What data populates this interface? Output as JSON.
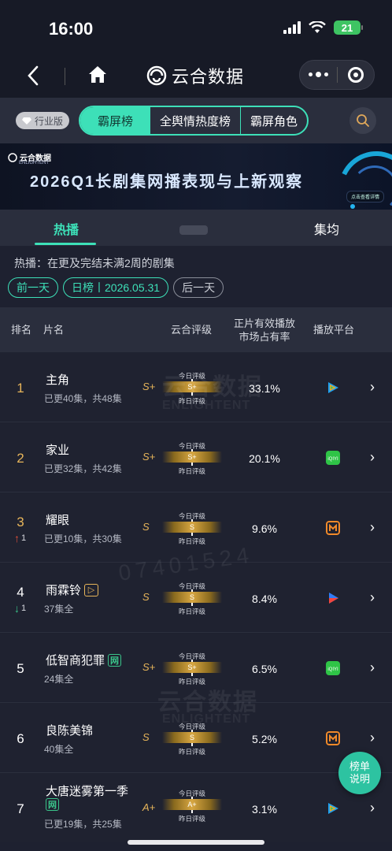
{
  "status_bar": {
    "time": "16:00",
    "battery": "21"
  },
  "nav": {
    "brand": "云合数据"
  },
  "tabs": {
    "industry_badge": "行业版",
    "items": [
      {
        "label": "霸屏榜",
        "active": true
      },
      {
        "label": "全舆情热度榜",
        "active": false
      },
      {
        "label": "霸屏角色",
        "active": false
      }
    ]
  },
  "banner": {
    "logo_cn": "云合数据",
    "logo_en": "ENLIGHTENT",
    "title": "2026Q1长剧集网播表现与上新观察",
    "pill": "点击查看详情"
  },
  "sub_tabs": [
    {
      "label": "热播",
      "active": true
    },
    {
      "label": "",
      "active": false
    },
    {
      "label": "集均",
      "active": false
    }
  ],
  "description": "热播：在更及完结未满2周的剧集",
  "date_nav": {
    "prev": "前一天",
    "current": "日榜丨2026.05.31",
    "next": "后一天"
  },
  "table_header": {
    "rank": "排名",
    "title": "片名",
    "rating": "云合评级",
    "share_line1": "正片有效播放",
    "share_line2": "市场占有率",
    "platform": "播放平台"
  },
  "rating_labels": {
    "today": "今日评级",
    "yesterday": "昨日评级"
  },
  "rows": [
    {
      "rank": "1",
      "title": "主角",
      "subtitle": "已更40集，共48集",
      "grade": "S+",
      "grade_today": "S+",
      "share": "33.1%",
      "platform": "tencent-icon",
      "rank_color": "#e7b55a",
      "change": "",
      "change_dir": "",
      "tag": ""
    },
    {
      "rank": "2",
      "title": "家业",
      "subtitle": "已更32集，共42集",
      "grade": "S+",
      "grade_today": "S+",
      "share": "20.1%",
      "platform": "iqiyi-icon",
      "rank_color": "#e7b55a",
      "change": "",
      "change_dir": "",
      "tag": ""
    },
    {
      "rank": "3",
      "title": "耀眼",
      "subtitle": "已更10集，共30集",
      "grade": "S",
      "grade_today": "S",
      "share": "9.6%",
      "platform": "mango-icon",
      "rank_color": "#e7b55a",
      "change": "1",
      "change_dir": "up",
      "tag": ""
    },
    {
      "rank": "4",
      "title": "雨霖铃",
      "subtitle": "37集全",
      "grade": "S",
      "grade_today": "S",
      "share": "8.4%",
      "platform": "youku-icon",
      "rank_color": "#ffffff",
      "change": "1",
      "change_dir": "down",
      "tag": "youku-badge-icon"
    },
    {
      "rank": "5",
      "title": "低智商犯罪",
      "subtitle": "24集全",
      "grade": "S+",
      "grade_today": "S+",
      "share": "6.5%",
      "platform": "iqiyi-icon",
      "rank_color": "#ffffff",
      "change": "",
      "change_dir": "",
      "tag": "网"
    },
    {
      "rank": "6",
      "title": "良陈美锦",
      "subtitle": "40集全",
      "grade": "S",
      "grade_today": "S",
      "share": "5.2%",
      "platform": "mango-icon",
      "rank_color": "#ffffff",
      "change": "",
      "change_dir": "",
      "tag": ""
    },
    {
      "rank": "7",
      "title": "大唐迷雾第一季",
      "subtitle": "已更19集，共25集",
      "grade": "A+",
      "grade_today": "A+",
      "share": "3.1%",
      "platform": "tencent-icon",
      "rank_color": "#ffffff",
      "change": "",
      "change_dir": "",
      "tag": "网"
    }
  ],
  "watermark": {
    "cn": "云合数据",
    "en": "ENLIGHTENT",
    "num": "07401524"
  },
  "fab": {
    "line1": "榜单",
    "line2": "说明"
  },
  "colors": {
    "accent": "#3de0b8",
    "background": "#1e2130",
    "gold": "#e7b55a"
  }
}
